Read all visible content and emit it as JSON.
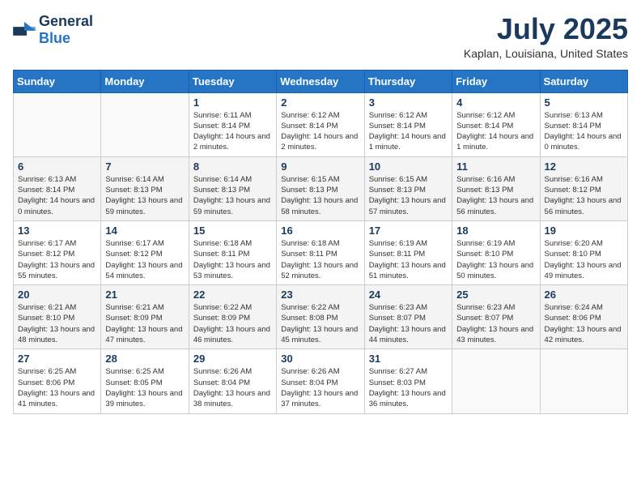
{
  "header": {
    "logo": {
      "general": "General",
      "blue": "Blue"
    },
    "title": "July 2025",
    "location": "Kaplan, Louisiana, United States"
  },
  "weekdays": [
    "Sunday",
    "Monday",
    "Tuesday",
    "Wednesday",
    "Thursday",
    "Friday",
    "Saturday"
  ],
  "weeks": [
    [
      {
        "day": null
      },
      {
        "day": null
      },
      {
        "day": 1,
        "sunrise": "6:11 AM",
        "sunset": "8:14 PM",
        "daylight": "14 hours and 2 minutes."
      },
      {
        "day": 2,
        "sunrise": "6:12 AM",
        "sunset": "8:14 PM",
        "daylight": "14 hours and 2 minutes."
      },
      {
        "day": 3,
        "sunrise": "6:12 AM",
        "sunset": "8:14 PM",
        "daylight": "14 hours and 1 minute."
      },
      {
        "day": 4,
        "sunrise": "6:12 AM",
        "sunset": "8:14 PM",
        "daylight": "14 hours and 1 minute."
      },
      {
        "day": 5,
        "sunrise": "6:13 AM",
        "sunset": "8:14 PM",
        "daylight": "14 hours and 0 minutes."
      }
    ],
    [
      {
        "day": 6,
        "sunrise": "6:13 AM",
        "sunset": "8:14 PM",
        "daylight": "14 hours and 0 minutes."
      },
      {
        "day": 7,
        "sunrise": "6:14 AM",
        "sunset": "8:13 PM",
        "daylight": "13 hours and 59 minutes."
      },
      {
        "day": 8,
        "sunrise": "6:14 AM",
        "sunset": "8:13 PM",
        "daylight": "13 hours and 59 minutes."
      },
      {
        "day": 9,
        "sunrise": "6:15 AM",
        "sunset": "8:13 PM",
        "daylight": "13 hours and 58 minutes."
      },
      {
        "day": 10,
        "sunrise": "6:15 AM",
        "sunset": "8:13 PM",
        "daylight": "13 hours and 57 minutes."
      },
      {
        "day": 11,
        "sunrise": "6:16 AM",
        "sunset": "8:13 PM",
        "daylight": "13 hours and 56 minutes."
      },
      {
        "day": 12,
        "sunrise": "6:16 AM",
        "sunset": "8:12 PM",
        "daylight": "13 hours and 56 minutes."
      }
    ],
    [
      {
        "day": 13,
        "sunrise": "6:17 AM",
        "sunset": "8:12 PM",
        "daylight": "13 hours and 55 minutes."
      },
      {
        "day": 14,
        "sunrise": "6:17 AM",
        "sunset": "8:12 PM",
        "daylight": "13 hours and 54 minutes."
      },
      {
        "day": 15,
        "sunrise": "6:18 AM",
        "sunset": "8:11 PM",
        "daylight": "13 hours and 53 minutes."
      },
      {
        "day": 16,
        "sunrise": "6:18 AM",
        "sunset": "8:11 PM",
        "daylight": "13 hours and 52 minutes."
      },
      {
        "day": 17,
        "sunrise": "6:19 AM",
        "sunset": "8:11 PM",
        "daylight": "13 hours and 51 minutes."
      },
      {
        "day": 18,
        "sunrise": "6:19 AM",
        "sunset": "8:10 PM",
        "daylight": "13 hours and 50 minutes."
      },
      {
        "day": 19,
        "sunrise": "6:20 AM",
        "sunset": "8:10 PM",
        "daylight": "13 hours and 49 minutes."
      }
    ],
    [
      {
        "day": 20,
        "sunrise": "6:21 AM",
        "sunset": "8:10 PM",
        "daylight": "13 hours and 48 minutes."
      },
      {
        "day": 21,
        "sunrise": "6:21 AM",
        "sunset": "8:09 PM",
        "daylight": "13 hours and 47 minutes."
      },
      {
        "day": 22,
        "sunrise": "6:22 AM",
        "sunset": "8:09 PM",
        "daylight": "13 hours and 46 minutes."
      },
      {
        "day": 23,
        "sunrise": "6:22 AM",
        "sunset": "8:08 PM",
        "daylight": "13 hours and 45 minutes."
      },
      {
        "day": 24,
        "sunrise": "6:23 AM",
        "sunset": "8:07 PM",
        "daylight": "13 hours and 44 minutes."
      },
      {
        "day": 25,
        "sunrise": "6:23 AM",
        "sunset": "8:07 PM",
        "daylight": "13 hours and 43 minutes."
      },
      {
        "day": 26,
        "sunrise": "6:24 AM",
        "sunset": "8:06 PM",
        "daylight": "13 hours and 42 minutes."
      }
    ],
    [
      {
        "day": 27,
        "sunrise": "6:25 AM",
        "sunset": "8:06 PM",
        "daylight": "13 hours and 41 minutes."
      },
      {
        "day": 28,
        "sunrise": "6:25 AM",
        "sunset": "8:05 PM",
        "daylight": "13 hours and 39 minutes."
      },
      {
        "day": 29,
        "sunrise": "6:26 AM",
        "sunset": "8:04 PM",
        "daylight": "13 hours and 38 minutes."
      },
      {
        "day": 30,
        "sunrise": "6:26 AM",
        "sunset": "8:04 PM",
        "daylight": "13 hours and 37 minutes."
      },
      {
        "day": 31,
        "sunrise": "6:27 AM",
        "sunset": "8:03 PM",
        "daylight": "13 hours and 36 minutes."
      },
      {
        "day": null
      },
      {
        "day": null
      }
    ]
  ],
  "labels": {
    "sunrise": "Sunrise:",
    "sunset": "Sunset:",
    "daylight": "Daylight:"
  }
}
